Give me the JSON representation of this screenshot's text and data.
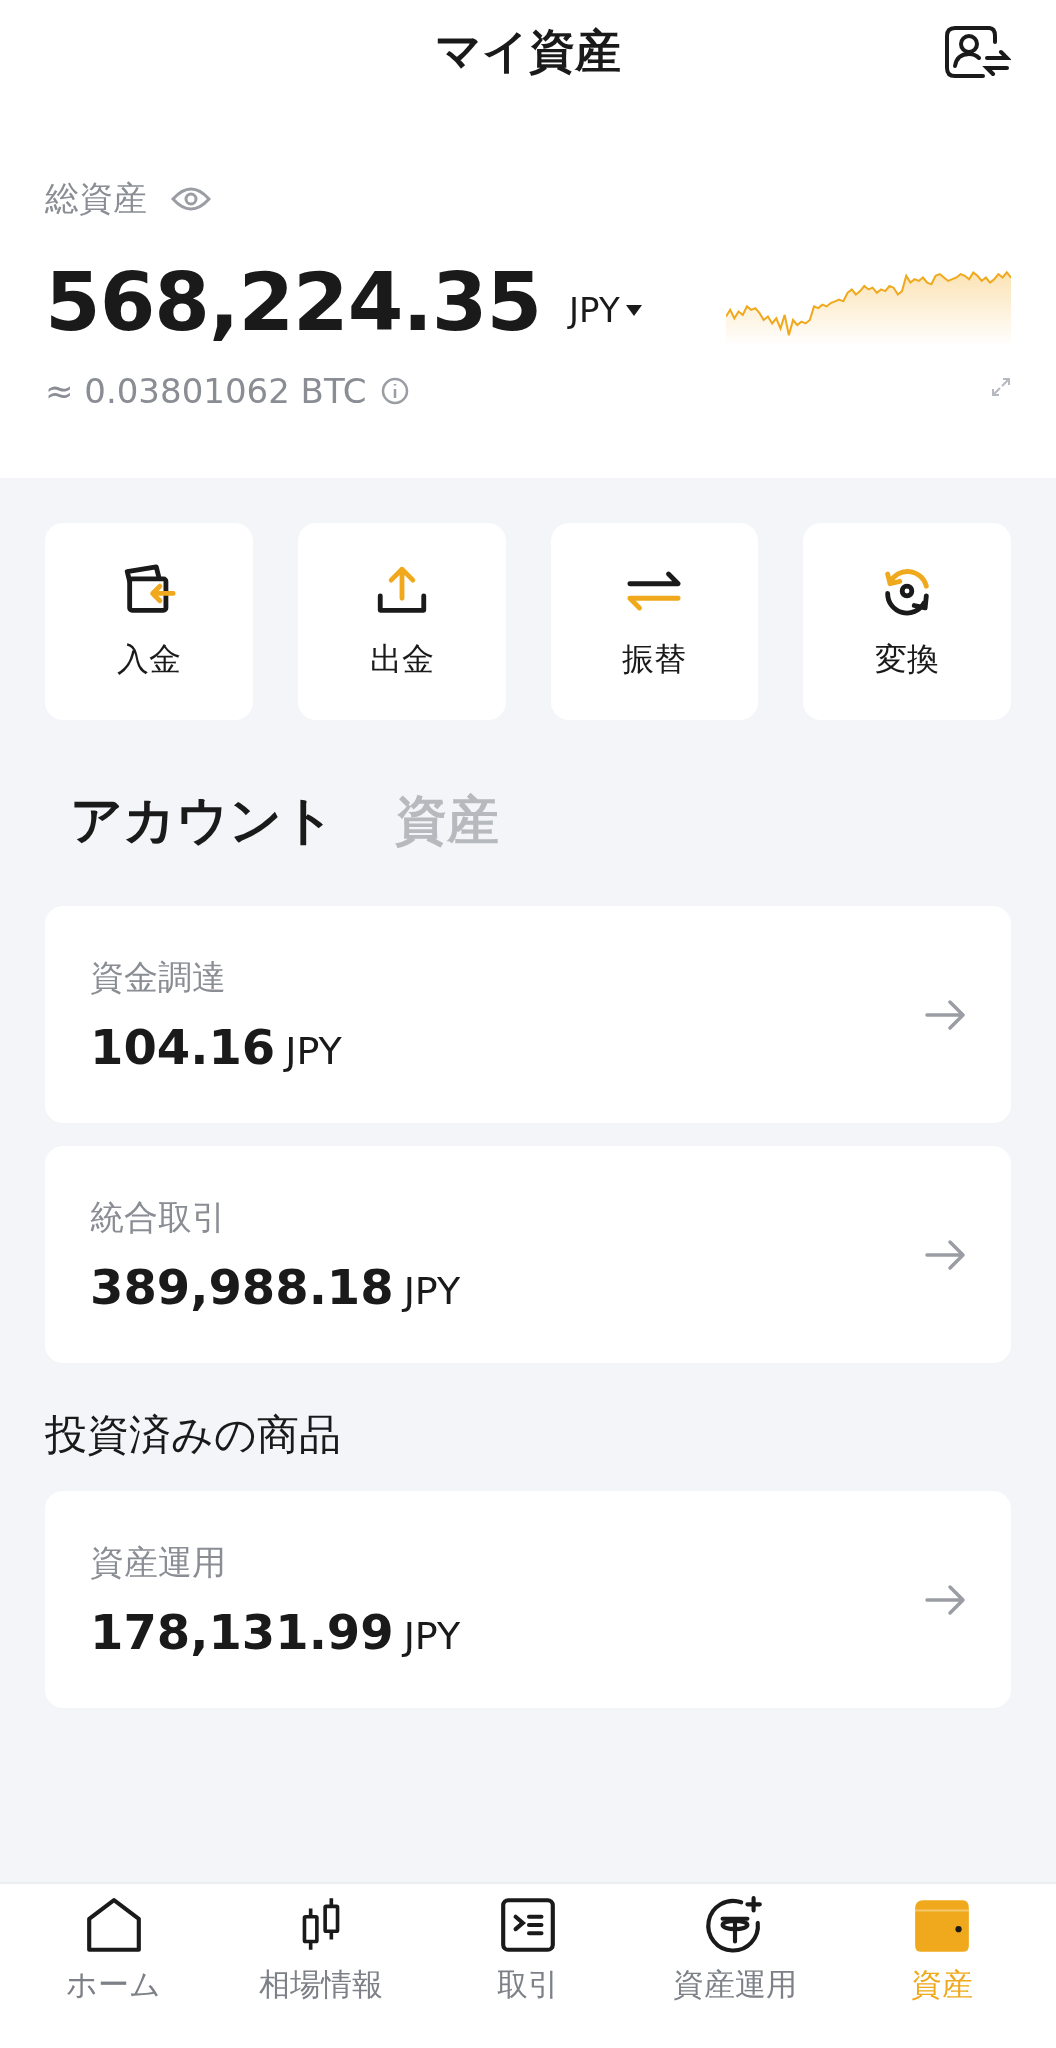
{
  "header": {
    "title": "マイ資産"
  },
  "summary": {
    "label": "総資産",
    "amount": "568,224.35",
    "currency": "JPY",
    "btc": "≈ 0.03801062 BTC"
  },
  "actions": [
    {
      "kind": "deposit",
      "label": "入金"
    },
    {
      "kind": "withdraw",
      "label": "出金"
    },
    {
      "kind": "transfer",
      "label": "振替"
    },
    {
      "kind": "convert",
      "label": "変換"
    }
  ],
  "tabs": [
    {
      "label": "アカウント",
      "selected": true
    },
    {
      "label": "資産",
      "selected": false
    }
  ],
  "accounts": [
    {
      "name": "資金調達",
      "amount": "104.16",
      "currency": "JPY"
    },
    {
      "name": "統合取引",
      "amount": "389,988.18",
      "currency": "JPY"
    }
  ],
  "products_heading": "投資済みの商品",
  "products": [
    {
      "name": "資産運用",
      "amount": "178,131.99",
      "currency": "JPY"
    }
  ],
  "nav": [
    {
      "kind": "home",
      "label": "ホーム",
      "selected": false
    },
    {
      "kind": "market",
      "label": "相場情報",
      "selected": false
    },
    {
      "kind": "trade",
      "label": "取引",
      "selected": false
    },
    {
      "kind": "earn",
      "label": "資産運用",
      "selected": false
    },
    {
      "kind": "assets",
      "label": "資産",
      "selected": true
    }
  ]
}
